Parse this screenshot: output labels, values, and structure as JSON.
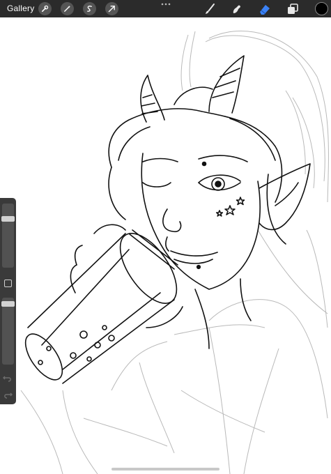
{
  "toolbar": {
    "gallery_label": "Gallery",
    "left_icons": [
      "wrench-icon",
      "magic-wand-icon",
      "selection-icon",
      "transform-arrow-icon"
    ],
    "right_icons": [
      "brush-icon",
      "smudge-icon",
      "eraser-icon",
      "layers-icon"
    ],
    "active_tool": "eraser",
    "active_tool_color": "#3b82f6",
    "current_color": "#000000"
  },
  "sidebar": {
    "brush_size": 0.17,
    "opacity": 0.06,
    "icons": [
      "modifier-square-icon",
      "undo-icon",
      "redo-icon"
    ]
  },
  "canvas": {
    "subject": "line-art-sketch"
  }
}
